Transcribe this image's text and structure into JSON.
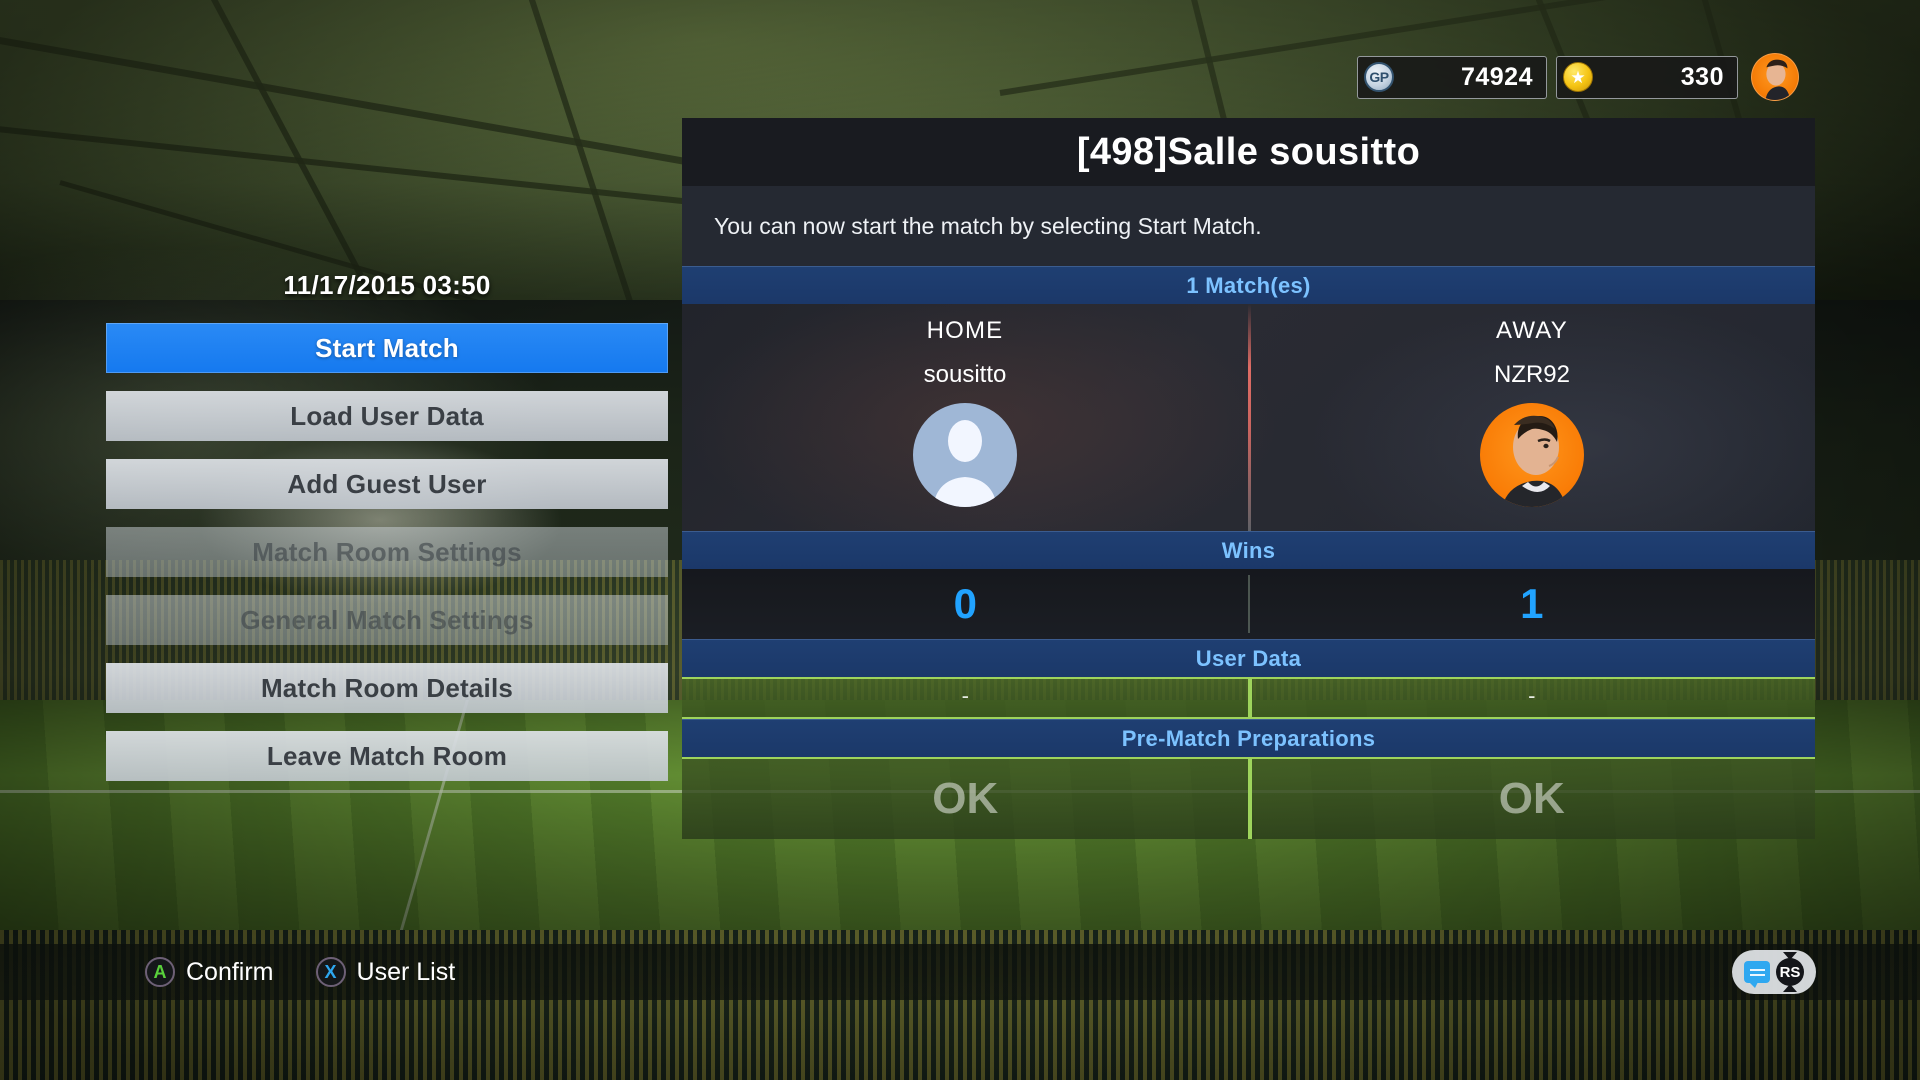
{
  "hud": {
    "gp_icon": "gp-coin-icon",
    "gp_value": "74924",
    "coin_icon": "star-coin-icon",
    "coin_value": "330",
    "avatar": "profile-avatar"
  },
  "left": {
    "datetime": "11/17/2015 03:50",
    "menu": [
      {
        "label": "Start Match",
        "state": "selected"
      },
      {
        "label": "Load User Data",
        "state": "normal"
      },
      {
        "label": "Add Guest User",
        "state": "normal"
      },
      {
        "label": "Match Room Settings",
        "state": "disabled"
      },
      {
        "label": "General Match Settings",
        "state": "disabled"
      },
      {
        "label": "Match Room Details",
        "state": "normal"
      },
      {
        "label": "Leave Match Room",
        "state": "normal"
      }
    ]
  },
  "panel": {
    "title": "[498]Salle sousitto",
    "description": "You can now start the match by selecting Start Match.",
    "match_count_label": "1 Match(es)",
    "home": {
      "side_label": "HOME",
      "name": "sousitto",
      "avatar": "default-user-avatar",
      "wins": "0",
      "user_data": "-",
      "pre_match": "OK"
    },
    "away": {
      "side_label": "AWAY",
      "name": "NZR92",
      "avatar": "player-photo-avatar",
      "wins": "1",
      "user_data": "-",
      "pre_match": "OK"
    },
    "sections": {
      "wins_label": "Wins",
      "user_data_label": "User Data",
      "pre_match_label": "Pre-Match Preparations"
    }
  },
  "bottom": {
    "hints": [
      {
        "button": "A",
        "label": "Confirm"
      },
      {
        "button": "X",
        "label": "User List"
      }
    ],
    "chat_icon": "chat-bubble-icon",
    "stick_icon": "right-stick-icon",
    "stick_label": "RS"
  },
  "colors": {
    "accent_blue": "#1579ef",
    "section_blue": "#1f3f72",
    "section_text": "#7cc2ff",
    "wins_text": "#21a3ff",
    "pitch_green": "#9ed45c"
  }
}
